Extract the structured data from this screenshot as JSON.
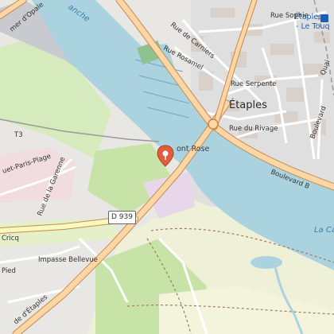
{
  "map": {
    "colors": {
      "background": "#f2efe9",
      "water": "#aad3df",
      "urban": "#e0dfdf",
      "building": "#d9d0c9",
      "green": "#c8e3a8",
      "forest": "#add19e",
      "runway": "#c9c9d0",
      "primary_road": "#fcd6a4",
      "primary_casing": "#c88a4c",
      "rail": "#999999",
      "pin": "#e05e3b"
    },
    "labels": {
      "town": "Étaples",
      "station_line1": "Étaples",
      "station_line2": "- Le Touq",
      "rue_sophie": "Rue Sophie",
      "rue_carniers": "Rue de Carniers",
      "rue_rosamel": "Rue Rosamel",
      "rue_serpente": "Rue Serpente",
      "rue_rivage": "Rue du Rivage",
      "boulevard_b": "Boulevard B",
      "boulevard": "Boulevard",
      "quai": "Quai",
      "paris_plage": "uet-Paris-Plage",
      "t3": "T3",
      "rue_garenne": "Rue de la Garenne",
      "impasse": "Impasse Bellevue",
      "rue_etaples": "de d'Étaples",
      "cricq": "Cricq",
      "pied": "Pied",
      "canche": "La Canche",
      "canche_top": "anche",
      "onale": "mer d'Opale",
      "la_ca": "La Ca",
      "d939": "D 939",
      "poi": "ont Rose"
    },
    "pin_icon": "map-pin-icon",
    "route_shield_icon": "route-shield-icon"
  }
}
